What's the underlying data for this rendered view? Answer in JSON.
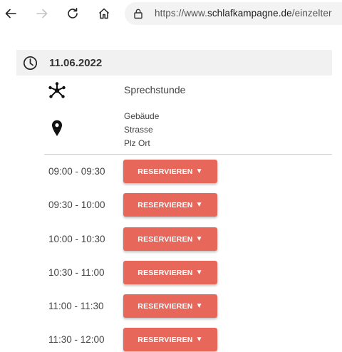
{
  "browser": {
    "url_prefix": "https://www.",
    "url_domain": "schlafkampagne.de",
    "url_path": "/einzelter"
  },
  "event": {
    "date": "11.06.2022",
    "title": "Sprechstunde",
    "address": [
      "Gebäude",
      "Strasse",
      "Plz Ort"
    ]
  },
  "slots": [
    {
      "time": "09:00 - 09:30",
      "button": "RESERVIEREN"
    },
    {
      "time": "09:30 - 10:00",
      "button": "RESERVIEREN"
    },
    {
      "time": "10:00 - 10:30",
      "button": "RESERVIEREN"
    },
    {
      "time": "10:30 - 11:00",
      "button": "RESERVIEREN"
    },
    {
      "time": "11:00 - 11:30",
      "button": "RESERVIEREN"
    },
    {
      "time": "11:30 - 12:00",
      "button": "RESERVIEREN"
    }
  ],
  "button_arrow": "▼",
  "colors": {
    "accent": "#e8675b",
    "date_bar": "#f1f1f1"
  }
}
